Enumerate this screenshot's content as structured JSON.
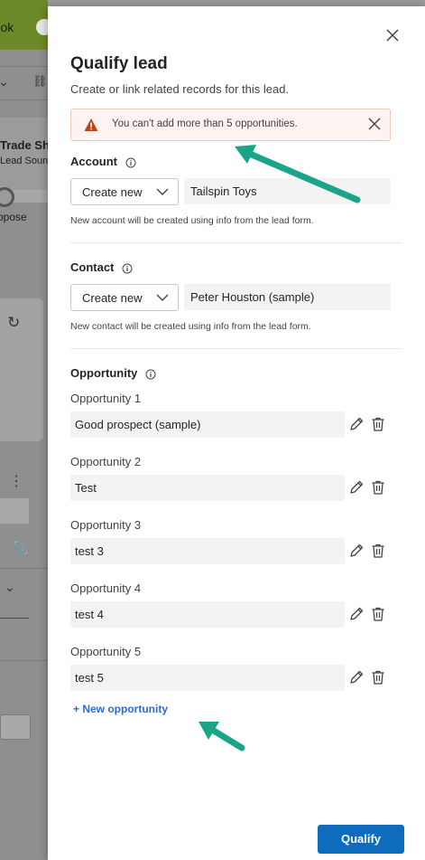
{
  "background": {
    "new_look_label": "new look",
    "record_title": "Trade Sho",
    "record_subtitle": "Lead Source",
    "stage_label": "Propose"
  },
  "dialog": {
    "title": "Qualify lead",
    "subtitle": "Create or link related records for this lead.",
    "alert": {
      "message": "You can't add more than 5 opportunities.",
      "icon": "warning-icon"
    },
    "account": {
      "label": "Account",
      "mode": "Create new",
      "name": "Tailspin Toys",
      "helper": "New account will be created using info from the lead form."
    },
    "contact": {
      "label": "Contact",
      "mode": "Create new",
      "name": "Peter Houston (sample)",
      "helper": "New contact will be created using info from the lead form."
    },
    "opportunity": {
      "label": "Opportunity",
      "items": [
        {
          "label": "Opportunity 1",
          "value": "Good prospect (sample)"
        },
        {
          "label": "Opportunity 2",
          "value": "Test"
        },
        {
          "label": "Opportunity 3",
          "value": "test 3"
        },
        {
          "label": "Opportunity 4",
          "value": "test 4"
        },
        {
          "label": "Opportunity 5",
          "value": "test 5"
        }
      ],
      "new_label": "+ New opportunity"
    },
    "qualify_label": "Qualify"
  },
  "colors": {
    "primary": "#0f6cbd",
    "alert_bg": "#fdf3f0",
    "warning": "#c4421a",
    "annotation_arrow": "#1aa58a"
  }
}
